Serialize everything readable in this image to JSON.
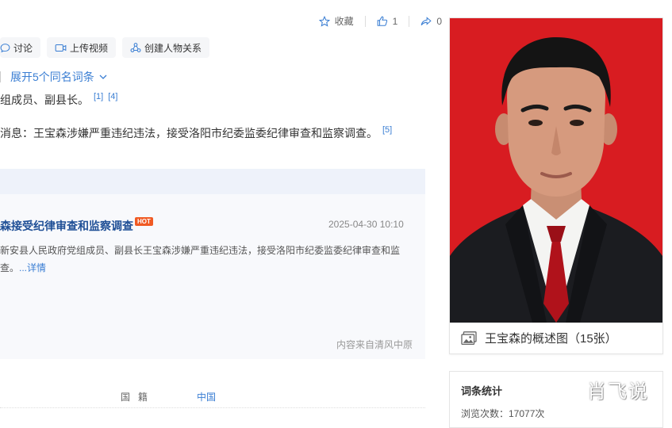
{
  "toolbar": {
    "favorite_label": "收藏",
    "like_count": "1",
    "share_count": "0"
  },
  "actions": {
    "discuss_label": "讨论",
    "upload_video_label": "上传视频",
    "create_relation_label": "创建人物关系"
  },
  "disambiguation": {
    "expand_label": "展开5个同名词条"
  },
  "summary": {
    "line1_text": "组成员、副县长。",
    "line1_ref_a": "[1]",
    "line1_ref_b": "[4]",
    "line2_text": "消息：王宝森涉嫌严重违纪违法，接受洛阳市纪委监委纪律审查和监察调查。",
    "line2_ref": "[5]"
  },
  "news": {
    "title": "森接受纪律审查和监察调查",
    "hot_badge": "HOT",
    "date": "2025-04-30 10:10",
    "body": "新安县人民政府党组成员、副县长王宝森涉嫌严重违纪违法，接受洛阳市纪委监委纪律审查和监",
    "body_tail": "查。",
    "more_label": "...详情",
    "source": "内容来自清风中原"
  },
  "basic_info": {
    "nationality_key": "国籍",
    "nationality_value": "中国"
  },
  "photo": {
    "caption": "王宝森的概述图（15张）",
    "background_color": "#d81c21"
  },
  "stats": {
    "title": "词条统计",
    "views": "浏览次数：17077次"
  },
  "watermark": "肖飞说",
  "colors": {
    "link": "#3a7ed3",
    "news_title": "#1f4f96",
    "hot": "#f05a24"
  }
}
